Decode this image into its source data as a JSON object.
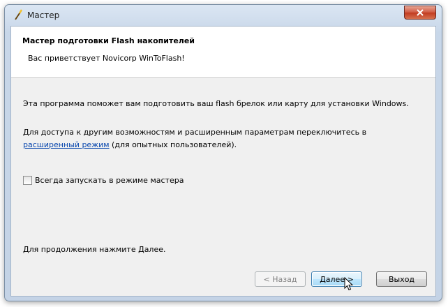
{
  "window": {
    "title": "Мастер"
  },
  "header": {
    "title": "Мастер подготовки Flash накопителей",
    "subtitle": "Вас приветствует Novicorp WinToFlash!"
  },
  "body": {
    "intro": "Эта программа поможет вам подготовить ваш flash брелок или карту для установки Windows.",
    "advanced_line1": "Для доступа к другим возможностям и расширенным параметрам переключитесь в",
    "advanced_link": "расширенный режим",
    "advanced_line2_rest": " (для опытных пользователей).",
    "checkbox_label": "Всегда запускать в режиме мастера",
    "checkbox_checked": false,
    "continue_hint": "Для продолжения нажмите Далее."
  },
  "buttons": {
    "back": "< Назад",
    "next": "Далее >",
    "exit": "Выход"
  },
  "icons": {
    "title_icon": "wand-icon",
    "close_icon": "close-icon",
    "cursor": "mouse-pointer-icon"
  }
}
